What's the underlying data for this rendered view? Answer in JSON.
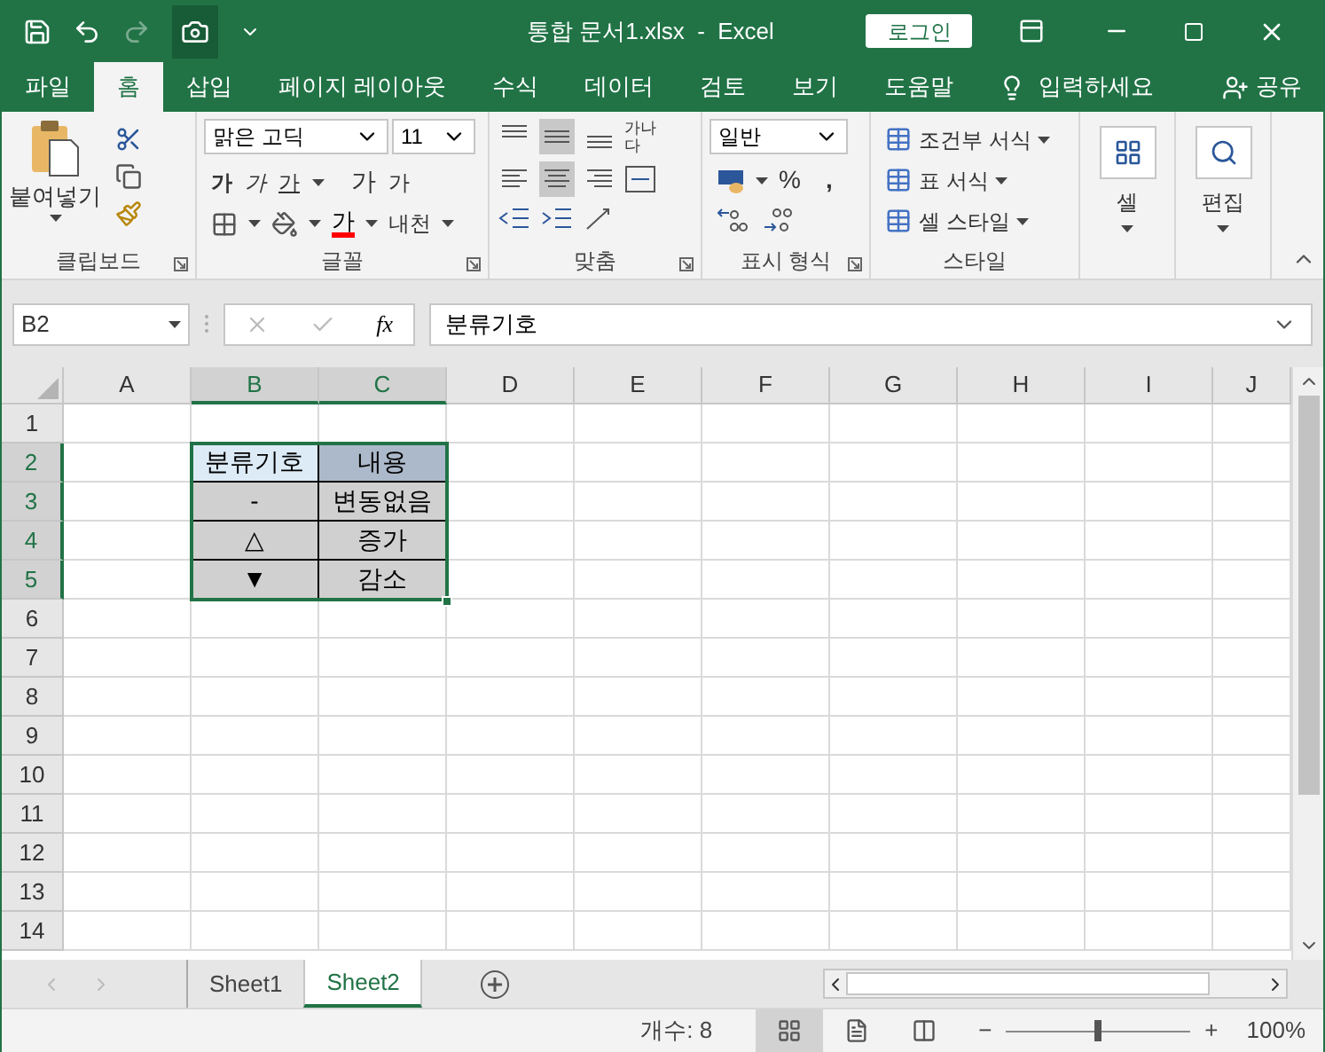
{
  "title_bar": {
    "document_title": "통합 문서1.xlsx  -  Excel",
    "login_button": "로그인"
  },
  "ribbon_tabs": [
    {
      "label": "파일",
      "selected": false
    },
    {
      "label": "홈",
      "selected": true
    },
    {
      "label": "삽입",
      "selected": false
    },
    {
      "label": "페이지 레이아웃",
      "selected": false
    },
    {
      "label": "수식",
      "selected": false
    },
    {
      "label": "데이터",
      "selected": false
    },
    {
      "label": "검토",
      "selected": false
    },
    {
      "label": "보기",
      "selected": false
    },
    {
      "label": "도움말",
      "selected": false
    }
  ],
  "tell_me": "입력하세요",
  "share": "공유",
  "ribbon": {
    "clipboard": {
      "paste": "붙여넣기",
      "group": "클립보드"
    },
    "font": {
      "name": "맑은 고딕",
      "size": "11",
      "bold": "가",
      "italic": "가",
      "underline": "가",
      "grow": "가",
      "shrink": "가",
      "font_color": "가",
      "phonetic": "내천",
      "group": "글꼴"
    },
    "alignment": {
      "wrap_text": "가나다",
      "group": "맞춤"
    },
    "number": {
      "format": "일반",
      "percent": "%",
      "comma": ",",
      "group": "표시 형식"
    },
    "styles": {
      "conditional": "조건부 서식",
      "table": "표 서식",
      "cell_styles": "셀 스타일",
      "group": "스타일"
    },
    "cells": "셀",
    "editing": "편집"
  },
  "formula_bar": {
    "name_box": "B2",
    "fx": "fx",
    "content": "분류기호"
  },
  "grid": {
    "columns": [
      {
        "label": "A",
        "selected": false
      },
      {
        "label": "B",
        "selected": true
      },
      {
        "label": "C",
        "selected": true
      },
      {
        "label": "D",
        "selected": false
      },
      {
        "label": "E",
        "selected": false
      },
      {
        "label": "F",
        "selected": false
      },
      {
        "label": "G",
        "selected": false
      },
      {
        "label": "H",
        "selected": false
      },
      {
        "label": "I",
        "selected": false
      },
      {
        "label": "J",
        "selected": false
      }
    ],
    "rows": [
      {
        "label": "1",
        "selected": false
      },
      {
        "label": "2",
        "selected": true
      },
      {
        "label": "3",
        "selected": true
      },
      {
        "label": "4",
        "selected": true
      },
      {
        "label": "5",
        "selected": true
      },
      {
        "label": "6",
        "selected": false
      },
      {
        "label": "7",
        "selected": false
      },
      {
        "label": "8",
        "selected": false
      },
      {
        "label": "9",
        "selected": false
      },
      {
        "label": "10",
        "selected": false
      },
      {
        "label": "11",
        "selected": false
      },
      {
        "label": "12",
        "selected": false
      },
      {
        "label": "13",
        "selected": false
      },
      {
        "label": "14",
        "selected": false
      }
    ],
    "table": [
      [
        {
          "text": "분류기호",
          "color": "#ddebf7"
        },
        {
          "text": "내용",
          "color": "#acb9ca"
        }
      ],
      [
        {
          "text": "-",
          "color": "#d0d0d0"
        },
        {
          "text": "변동없음",
          "color": "#d0d0d0"
        }
      ],
      [
        {
          "text": "△",
          "color": "#d0d0d0"
        },
        {
          "text": "증가",
          "color": "#d0d0d0"
        }
      ],
      [
        {
          "text": "▼",
          "color": "#d0d0d0"
        },
        {
          "text": "감소",
          "color": "#d0d0d0"
        }
      ]
    ]
  },
  "sheets": [
    {
      "label": "Sheet1",
      "selected": false
    },
    {
      "label": "Sheet2",
      "selected": true
    }
  ],
  "status_bar": {
    "count": "개수: 8",
    "views": [
      {
        "kind": "normal",
        "selected": true
      },
      {
        "kind": "page_layout",
        "selected": false
      },
      {
        "kind": "page_break",
        "selected": false
      }
    ],
    "zoom": {
      "minus": "−",
      "plus": "+",
      "level": 0.5,
      "reading": "100%"
    }
  }
}
